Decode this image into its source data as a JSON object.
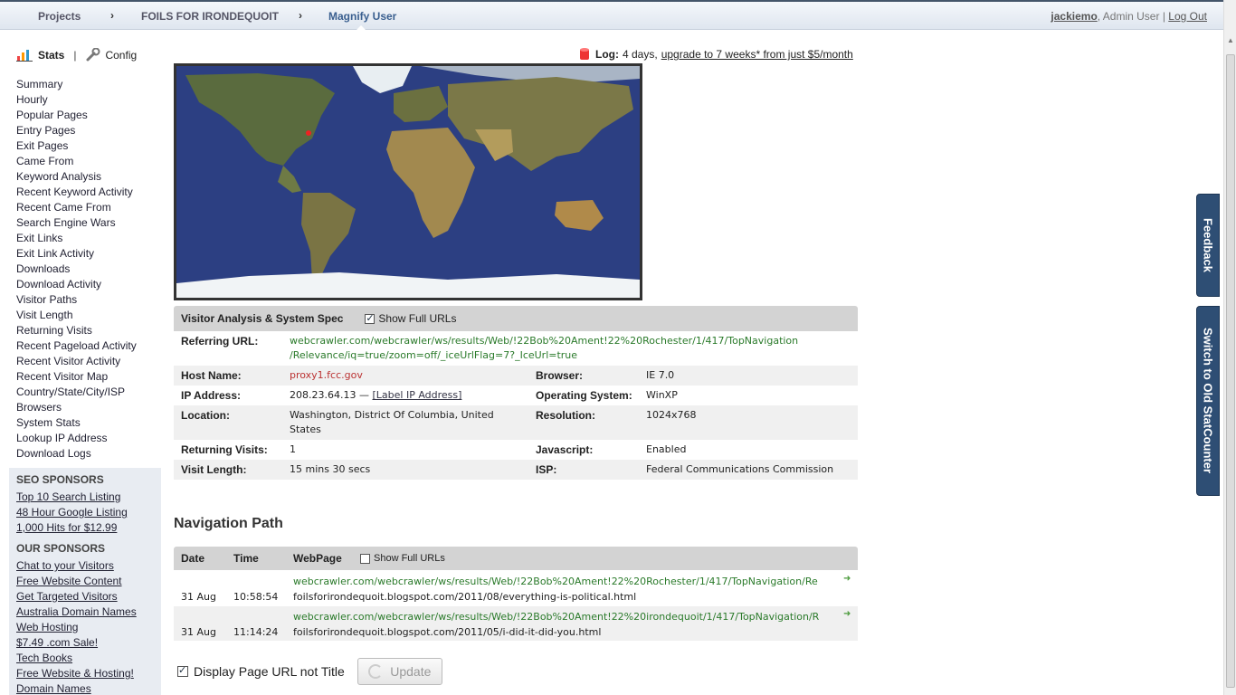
{
  "breadcrumb": {
    "items": [
      "Projects",
      "FOILS FOR IRONDEQUOIT",
      "Magnify User"
    ],
    "separator": "›"
  },
  "user": {
    "name": "jackiemo",
    "role": ", Admin User",
    "divider": "|",
    "logout": "Log Out"
  },
  "sidetabs": {
    "feedback": "Feedback",
    "old": "Switch to Old StatCounter"
  },
  "leftnav": {
    "stats": "Stats",
    "sep": "|",
    "config": "Config",
    "items": [
      "Summary",
      "Hourly",
      "Popular Pages",
      "Entry Pages",
      "Exit Pages",
      "Came From",
      "Keyword Analysis",
      "Recent Keyword Activity",
      "Recent Came From",
      "Search Engine Wars",
      "Exit Links",
      "Exit Link Activity",
      "Downloads",
      "Download Activity",
      "Visitor Paths",
      "Visit Length",
      "Returning Visits",
      "Recent Pageload Activity",
      "Recent Visitor Activity",
      "Recent Visitor Map",
      "Country/State/City/ISP",
      "Browsers",
      "System Stats",
      "Lookup IP Address",
      "Download Logs"
    ]
  },
  "sponsors": {
    "seo_head": "SEO SPONSORS",
    "seo_links": [
      "Top 10 Search Listing",
      "48 Hour Google Listing",
      "1,000 Hits for $12.99"
    ],
    "our_head": "OUR SPONSORS",
    "our_links": [
      "Chat to your Visitors",
      "Free Website Content",
      "Get Targeted Visitors",
      "Australia Domain Names",
      "Web Hosting",
      "$7.49 .com Sale!",
      "Tech Books",
      "Free Website & Hosting!",
      "Domain Names"
    ]
  },
  "log": {
    "label": "Log:",
    "duration": "4 days,",
    "upgrade": "upgrade to 7 weeks* from just $5/month"
  },
  "analysis": {
    "title": "Visitor Analysis & System Spec",
    "show_full": "Show Full URLs",
    "referring_label": "Referring URL:",
    "referring_line1": "webcrawler.com/webcrawler/ws/results/Web/!22Bob%20Ament!22%20Rochester/1/417/TopNavigation",
    "referring_line2": "/Relevance/iq=true/zoom=off/_iceUrlFlag=7?_IceUrl=true",
    "host_label": "Host Name:",
    "host": "proxy1.fcc.gov",
    "browser_label": "Browser:",
    "browser": "IE 7.0",
    "ip_label": "IP Address:",
    "ip": "208.23.64.13",
    "ip_dash": "—",
    "ip_link": "[Label IP Address]",
    "os_label": "Operating System:",
    "os": "WinXP",
    "loc_label": "Location:",
    "loc_line1": "Washington, District Of Columbia, United",
    "loc_line2": "States",
    "res_label": "Resolution:",
    "res": "1024x768",
    "ret_label": "Returning Visits:",
    "ret": "1",
    "js_label": "Javascript:",
    "js": "Enabled",
    "len_label": "Visit Length:",
    "len": "15 mins 30 secs",
    "isp_label": "ISP:",
    "isp": "Federal Communications Commission"
  },
  "navpath": {
    "title": "Navigation Path",
    "col_date": "Date",
    "col_time": "Time",
    "col_page": "WebPage",
    "show_full": "Show Full URLs",
    "rows": [
      {
        "date": "31 Aug",
        "time": "10:58:54",
        "ref": "webcrawler.com/webcrawler/ws/results/Web/!22Bob%20Ament!22%20Rochester/1/417/TopNavigation/Re",
        "page": "foilsforirondequoit.blogspot.com/2011/08/everything-is-political.html"
      },
      {
        "date": "31 Aug",
        "time": "11:14:24",
        "ref": "webcrawler.com/webcrawler/ws/results/Web/!22Bob%20Ament!22%20irondequoit/1/417/TopNavigation/R",
        "page": "foilsforirondequoit.blogspot.com/2011/05/i-did-it-did-you.html"
      }
    ]
  },
  "bottom": {
    "display_label": "Display Page URL not Title",
    "update": "Update"
  },
  "colors": {
    "accent": "#2e4e74",
    "link_green": "#2a7a2a",
    "host_red": "#b33333"
  }
}
